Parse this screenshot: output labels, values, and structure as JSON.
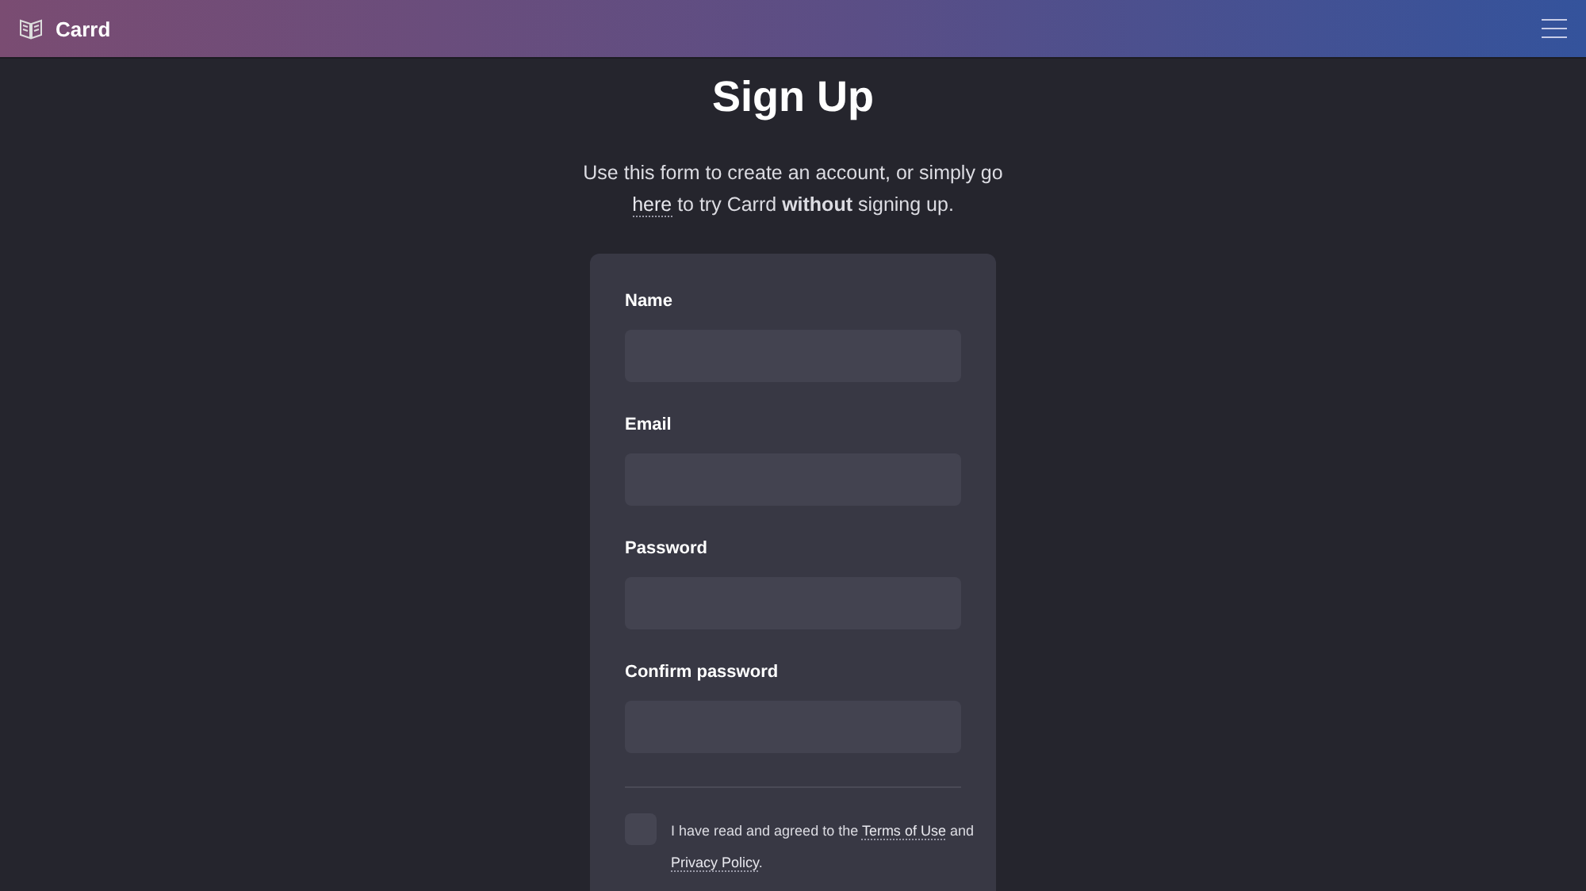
{
  "header": {
    "brand": "Carrd"
  },
  "title": "Sign Up",
  "intro": [
    {
      "kind": "text",
      "text": "Use this form to create an account, or simply go "
    },
    {
      "kind": "link",
      "text": "here"
    },
    {
      "kind": "text",
      "text": " to try Carrd **without** signing up."
    }
  ],
  "fields": [
    {
      "label": "Name"
    },
    {
      "label": "Email"
    },
    {
      "label": "Password"
    },
    {
      "label": "Confirm password"
    }
  ],
  "agreement": {
    "checked": false,
    "parts": [
      {
        "kind": "text",
        "text": "I have read and agreed to the "
      },
      {
        "kind": "link",
        "text": "Terms of Use"
      },
      {
        "kind": "text",
        "text": " and "
      },
      {
        "kind": "link",
        "text": "Privacy Policy"
      },
      {
        "kind": "text",
        "text": "."
      }
    ]
  }
}
